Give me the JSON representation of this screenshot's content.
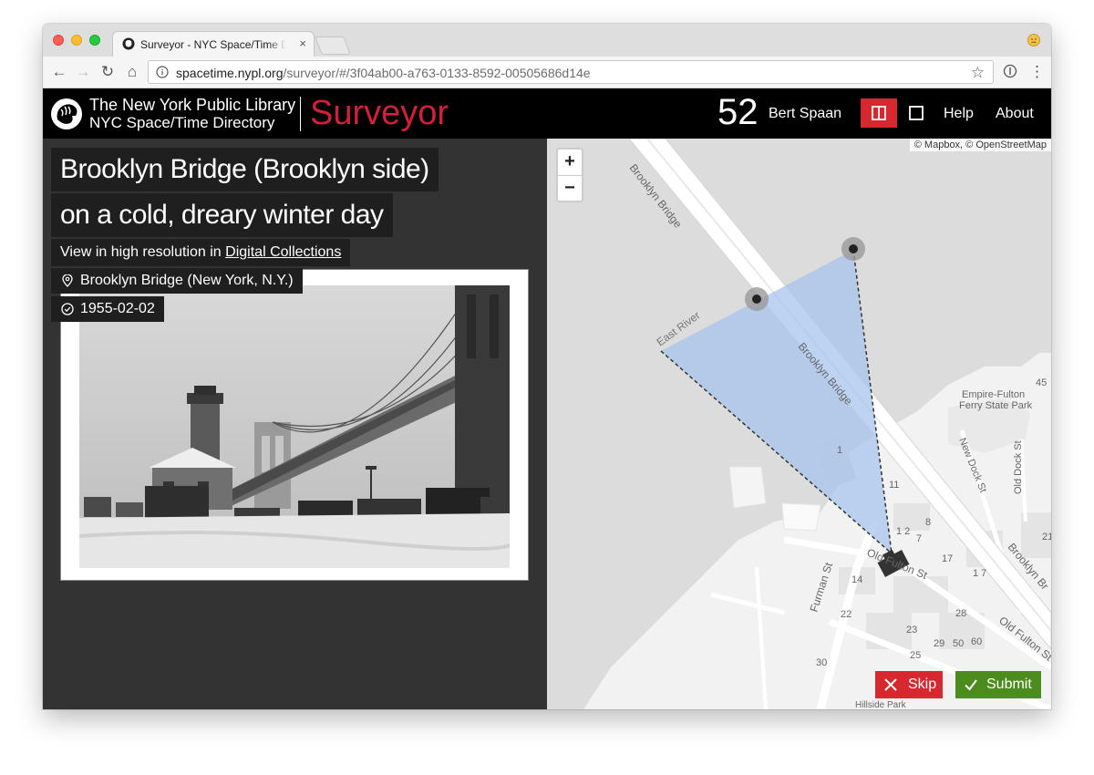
{
  "browser": {
    "tab_title": "Surveyor - NYC Space/Time Directory",
    "tab_close": "×",
    "url_host": "spacetime.nypl.org",
    "url_path": "/surveyor/#/3f04ab00-a763-0133-8592-00505686d14e",
    "nav_back": "←",
    "nav_forward": "→",
    "nav_reload": "↻",
    "nav_home": "⌂",
    "star": "☆",
    "menu": "⋮",
    "icons": [
      "favicon-icon",
      "info-icon",
      "star-icon",
      "extension-icon",
      "menu-icon",
      "profile-icon"
    ]
  },
  "header": {
    "org_line1": "The New York Public Library",
    "org_line2": "NYC Space/Time Directory",
    "app_name": "Surveyor",
    "score": "52",
    "username": "Bert Spaan",
    "help": "Help",
    "about": "About",
    "colors": {
      "background": "#000000",
      "accent": "#d0203a",
      "active_button": "#d7282f"
    }
  },
  "item": {
    "title_line1": "Brooklyn Bridge (Brooklyn side)",
    "title_line2": "on a cold, dreary winter day",
    "hires_prefix": "View in high resolution in ",
    "hires_link": "Digital Collections",
    "location": "Brooklyn Bridge (New York, N.Y.)",
    "date": "1955-02-02"
  },
  "map": {
    "attribution": "© Mapbox, © OpenStreetMap",
    "zoom_in": "+",
    "zoom_out": "−",
    "labels": {
      "bridge_top": "Brooklyn Bridge",
      "bridge_mid": "Brooklyn Bridge",
      "bridge_right": "Brooklyn Br",
      "river": "East River",
      "park_line1": "Empire-Fulton",
      "park_line2": "Ferry State Park",
      "new_dock": "New Dock St",
      "old_dock": "Old Dock St",
      "furman": "Furman St",
      "old_fulton": "Old Fulton St",
      "old_fulton_lower": "Old Fulton St",
      "hillside": "Hillside Park",
      "n45": "45",
      "n21": "21",
      "n11": "11",
      "n1": "1",
      "n8": "8",
      "n12": "1 2",
      "n7": "7",
      "n17": "17",
      "n17b": "1 7",
      "n14": "14",
      "n22": "22",
      "n28": "28",
      "n23": "23",
      "n29": "29",
      "n50": "50",
      "n60": "60",
      "n25": "25",
      "n30": "30"
    },
    "colors": {
      "field_of_view": "#a8c4ec",
      "water": "#dcdcdc",
      "land": "#f2f2f2"
    }
  },
  "actions": {
    "skip": "Skip",
    "submit": "Submit",
    "skip_color": "#d7282f",
    "submit_color": "#4c8c1c"
  }
}
